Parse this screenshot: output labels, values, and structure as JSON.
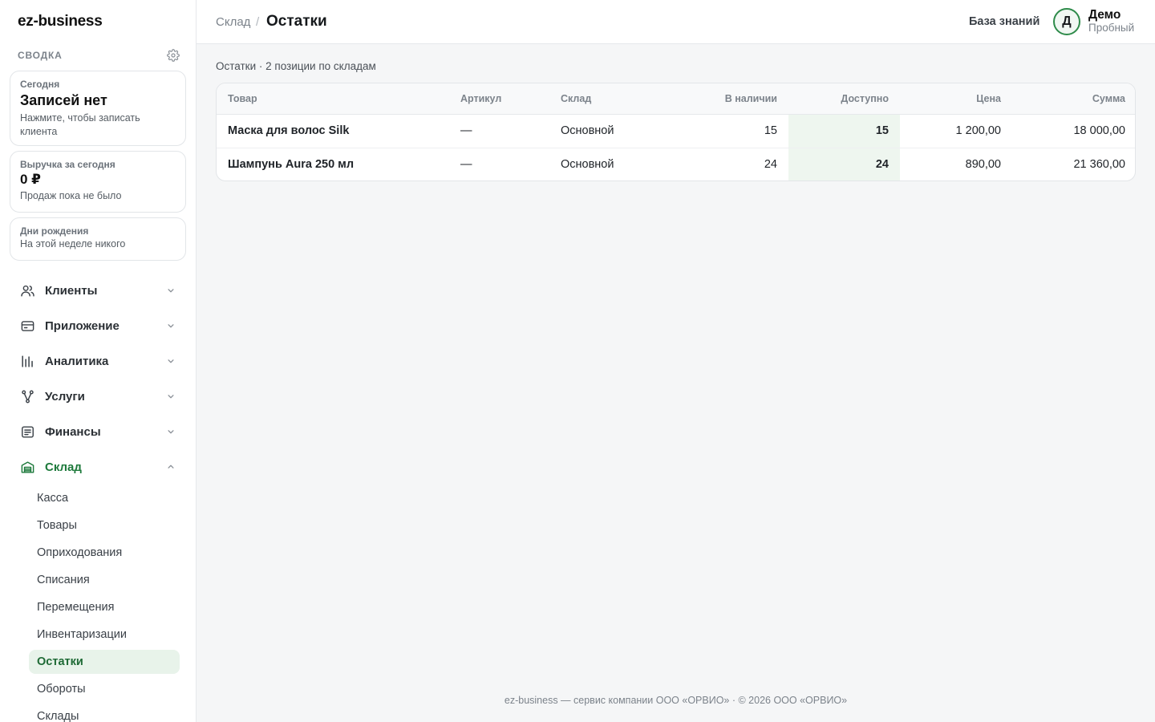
{
  "app": {
    "logo": "ez-business"
  },
  "sidebar": {
    "summary_label": "СВОДКА",
    "cards": {
      "today": {
        "label": "Сегодня",
        "title": "Записей нет",
        "text": "Нажмите, чтобы записать клиента"
      },
      "revenue": {
        "label": "Выручка за сегодня",
        "value": "0 ₽",
        "text": "Продаж пока не было"
      },
      "birthdays": {
        "label": "Дни рождения",
        "text": "На этой неделе никого"
      }
    },
    "nav": [
      {
        "label": "Клиенты",
        "icon": "users-icon"
      },
      {
        "label": "Приложение",
        "icon": "card-icon"
      },
      {
        "label": "Аналитика",
        "icon": "bar-chart-icon"
      },
      {
        "label": "Услуги",
        "icon": "branch-icon"
      },
      {
        "label": "Финансы",
        "icon": "receipt-icon"
      },
      {
        "label": "Склад",
        "icon": "warehouse-icon",
        "expanded": true
      }
    ],
    "sub_items": [
      "Касса",
      "Товары",
      "Оприходования",
      "Списания",
      "Перемещения",
      "Инвентаризации",
      "Остатки",
      "Обороты",
      "Склады"
    ],
    "active_sub": "Остатки",
    "accent_color": "#1e7a3c"
  },
  "header": {
    "breadcrumb_parent": "Склад",
    "breadcrumb_sep": "/",
    "title": "Остатки",
    "kb_link": "База знаний",
    "user": {
      "initial": "Д",
      "name": "Демо",
      "plan": "Пробный"
    }
  },
  "main": {
    "subtitle": "Остатки · 2 позиции по складам",
    "table": {
      "columns": [
        "Товар",
        "Артикул",
        "Склад",
        "В наличии",
        "Доступно",
        "Цена",
        "Сумма"
      ],
      "rows": [
        [
          "Маска для волос Silk",
          "—",
          "Основной",
          "15",
          "15",
          "1 200,00",
          "18 000,00"
        ],
        [
          "Шампунь Aura 250 мл",
          "—",
          "Основной",
          "24",
          "24",
          "890,00",
          "21 360,00"
        ]
      ]
    }
  },
  "footer": {
    "text": "ez-business — сервис компании ООО «ОРВИО» · © 2026 ООО «ОРВИО»"
  }
}
